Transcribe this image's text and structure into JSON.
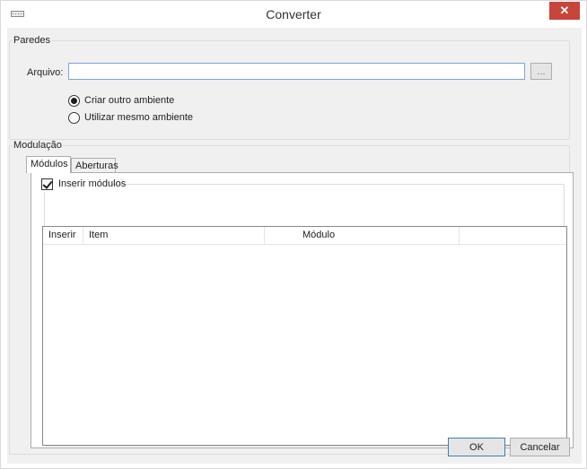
{
  "window": {
    "title": "Converter",
    "close_glyph": "✕"
  },
  "paredes": {
    "legend": "Paredes",
    "arquivo_label": "Arquivo:",
    "arquivo_value": "",
    "browse_label": "...",
    "radios": [
      {
        "label": "Criar outro ambiente",
        "checked": true
      },
      {
        "label": "Utilizar mesmo ambiente",
        "checked": false
      }
    ]
  },
  "modulacao": {
    "legend": "Modulação",
    "tabs": [
      {
        "label": "Módulos",
        "active": true
      },
      {
        "label": "Aberturas",
        "active": false
      }
    ],
    "inserir_modulos": {
      "label": "Inserir módulos",
      "checked": true
    },
    "table": {
      "columns": [
        "Inserir",
        "Item",
        "Módulo",
        ""
      ],
      "rows": []
    }
  },
  "buttons": {
    "ok": "OK",
    "cancel": "Cancelar"
  },
  "colors": {
    "close_button": "#c7453b",
    "dialog_bg": "#f0f0f0",
    "focus_border": "#7aa7d6"
  }
}
